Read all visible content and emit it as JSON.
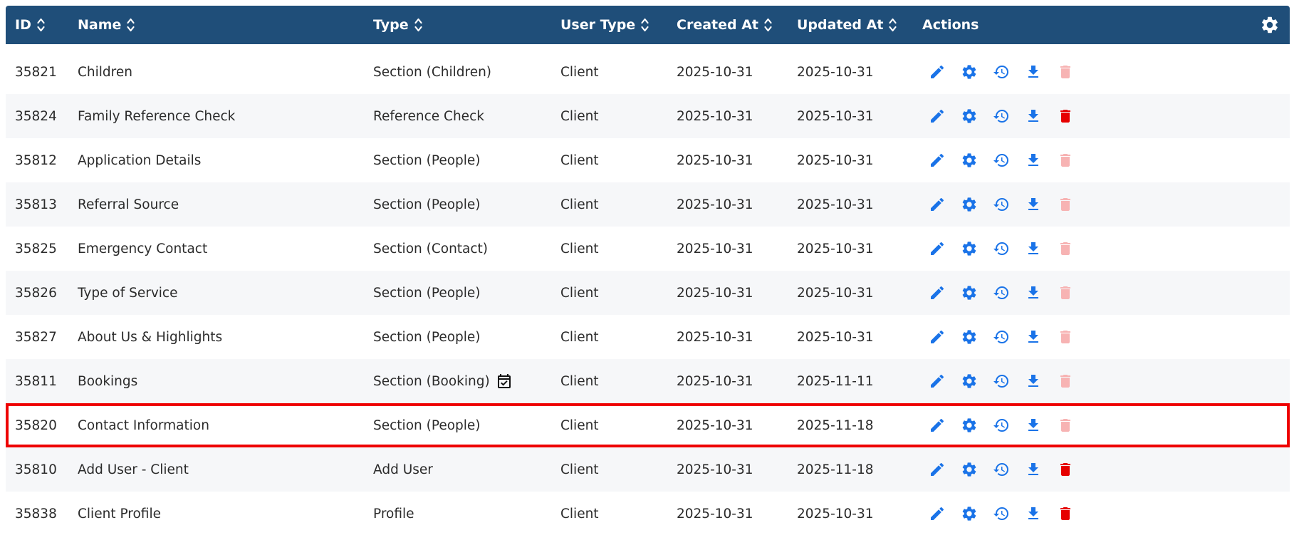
{
  "header": {
    "columns": {
      "id": "ID",
      "name": "Name",
      "type": "Type",
      "user_type": "User Type",
      "created_at": "Created At",
      "updated_at": "Updated At",
      "actions": "Actions"
    },
    "settings_icon": "gear-icon"
  },
  "colors": {
    "header_bg": "#1f4e79",
    "action_blue": "#1a73e8",
    "delete_active": "#e60000",
    "delete_disabled": "#f7b3b3",
    "highlight_border": "#ee0000"
  },
  "action_icons": [
    "pencil-icon",
    "gear-icon",
    "history-icon",
    "download-icon",
    "trash-icon"
  ],
  "rows": [
    {
      "id": "35821",
      "name": "Children",
      "type": "Section (Children)",
      "user_type": "Client",
      "created_at": "2025-10-31",
      "updated_at": "2025-10-31",
      "delete_enabled": false
    },
    {
      "id": "35824",
      "name": "Family Reference Check",
      "type": "Reference Check",
      "user_type": "Client",
      "created_at": "2025-10-31",
      "updated_at": "2025-10-31",
      "delete_enabled": true
    },
    {
      "id": "35812",
      "name": "Application Details",
      "type": "Section (People)",
      "user_type": "Client",
      "created_at": "2025-10-31",
      "updated_at": "2025-10-31",
      "delete_enabled": false
    },
    {
      "id": "35813",
      "name": "Referral Source",
      "type": "Section (People)",
      "user_type": "Client",
      "created_at": "2025-10-31",
      "updated_at": "2025-10-31",
      "delete_enabled": false
    },
    {
      "id": "35825",
      "name": "Emergency Contact",
      "type": "Section (Contact)",
      "user_type": "Client",
      "created_at": "2025-10-31",
      "updated_at": "2025-10-31",
      "delete_enabled": false
    },
    {
      "id": "35826",
      "name": "Type of Service",
      "type": "Section (People)",
      "user_type": "Client",
      "created_at": "2025-10-31",
      "updated_at": "2025-10-31",
      "delete_enabled": false
    },
    {
      "id": "35827",
      "name": "About Us & Highlights",
      "type": "Section (People)",
      "user_type": "Client",
      "created_at": "2025-10-31",
      "updated_at": "2025-10-31",
      "delete_enabled": false
    },
    {
      "id": "35811",
      "name": "Bookings",
      "type": "Section (Booking)",
      "user_type": "Client",
      "created_at": "2025-10-31",
      "updated_at": "2025-11-11",
      "delete_enabled": false,
      "type_icon": "calendar-check-icon"
    },
    {
      "id": "35820",
      "name": "Contact Information",
      "type": "Section (People)",
      "user_type": "Client",
      "created_at": "2025-10-31",
      "updated_at": "2025-11-18",
      "delete_enabled": false,
      "highlighted": true
    },
    {
      "id": "35810",
      "name": "Add User - Client",
      "type": "Add User",
      "user_type": "Client",
      "created_at": "2025-10-31",
      "updated_at": "2025-11-18",
      "delete_enabled": true
    },
    {
      "id": "35838",
      "name": "Client Profile",
      "type": "Profile",
      "user_type": "Client",
      "created_at": "2025-10-31",
      "updated_at": "2025-10-31",
      "delete_enabled": true
    }
  ]
}
